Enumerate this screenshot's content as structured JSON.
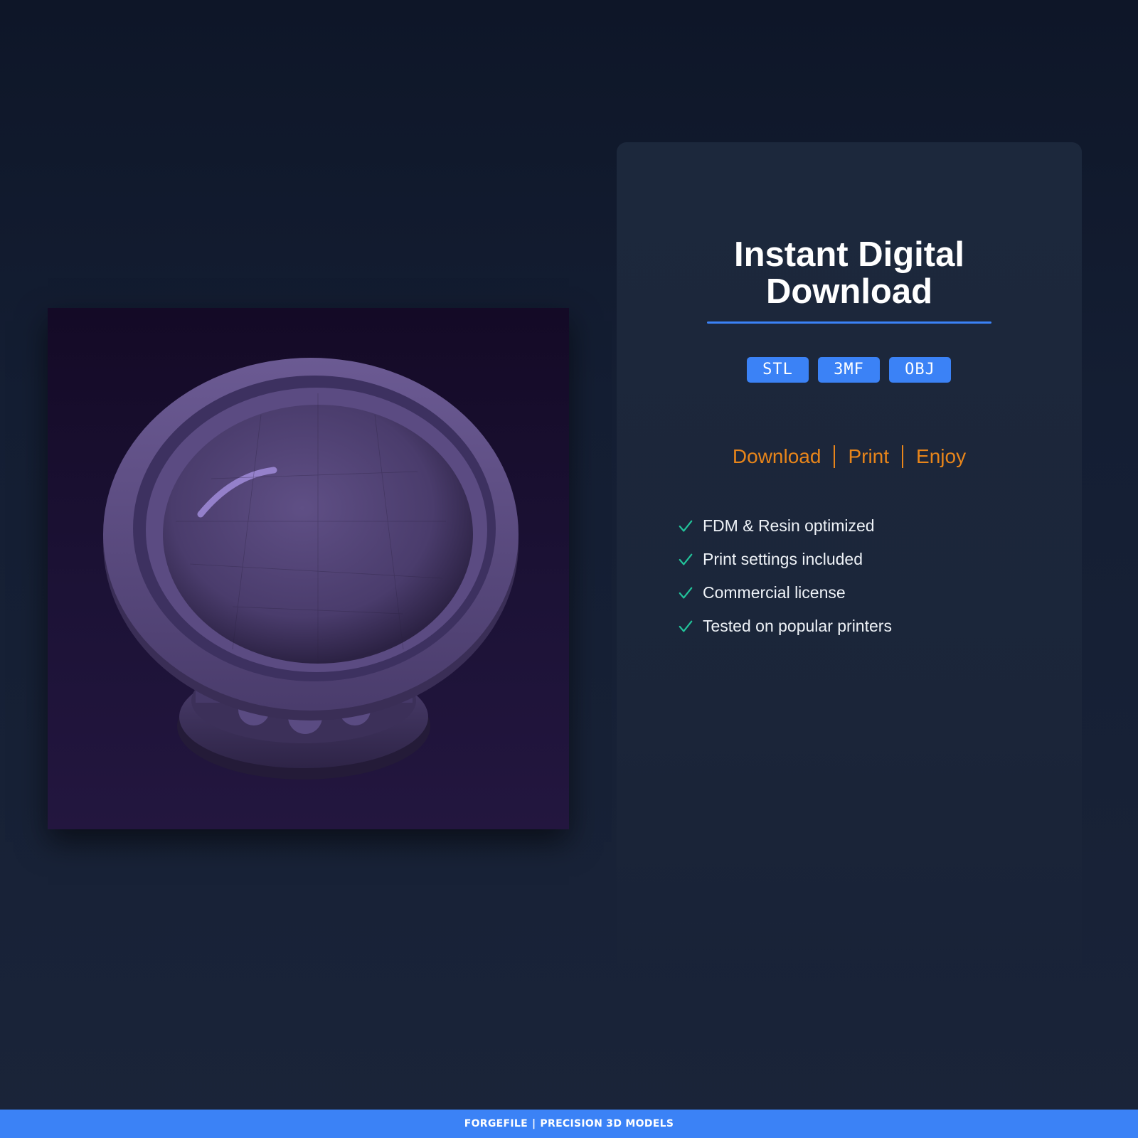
{
  "product": {
    "image_alt": "purple 3D printed pedestal bowl"
  },
  "card": {
    "title_line1": "Instant Digital",
    "title_line2": "Download",
    "formats": [
      "STL",
      "3MF",
      "OBJ"
    ],
    "steps": [
      "Download",
      "Print",
      "Enjoy"
    ],
    "features": [
      "FDM & Resin optimized",
      "Print settings included",
      "Commercial license",
      "Tested on popular printers"
    ]
  },
  "footer": {
    "brand": "FORGEFILE",
    "separator": "|",
    "tagline": "PRECISION 3D MODELS"
  },
  "colors": {
    "accent_blue": "#3b82f6",
    "accent_orange": "#e8851a",
    "check_green": "#22c39a",
    "background": "#141e33",
    "bowl_purple": "#5a4a7e"
  },
  "icons": {
    "feature_bullet": "check-icon"
  }
}
